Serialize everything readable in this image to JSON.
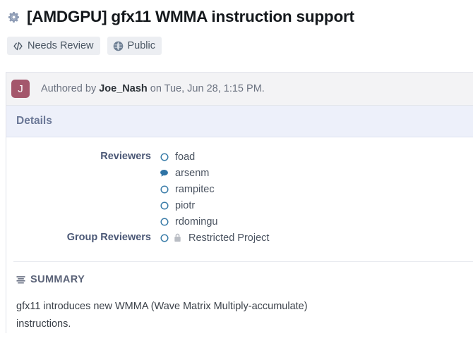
{
  "header": {
    "icon": "gear-icon",
    "title": "[AMDGPU] gfx11 WMMA instruction support",
    "badges": [
      {
        "icon": "code-brackets-icon",
        "label": "Needs Review"
      },
      {
        "icon": "globe-icon",
        "label": "Public"
      }
    ]
  },
  "author": {
    "avatar_initial": "J",
    "avatar_color": "#a4576c",
    "prefix": "Authored by ",
    "name": "Joe_Nash",
    "suffix": " on Tue, Jun 28, 1:15 PM."
  },
  "details": {
    "section_title": "Details",
    "reviewers_label": "Reviewers",
    "reviewers": [
      {
        "name": "foad",
        "icon": "circle-outline-icon",
        "status": "pending"
      },
      {
        "name": "arsenm",
        "icon": "comment-bubble-icon",
        "status": "commented"
      },
      {
        "name": "rampitec",
        "icon": "circle-outline-icon",
        "status": "pending"
      },
      {
        "name": "piotr",
        "icon": "circle-outline-icon",
        "status": "pending"
      },
      {
        "name": "rdomingu",
        "icon": "circle-outline-icon",
        "status": "pending"
      }
    ],
    "group_reviewers_label": "Group Reviewers",
    "group_reviewers": [
      {
        "name": "Restricted Project",
        "icon": "circle-outline-icon",
        "secondary_icon": "lock-icon",
        "status": "pending"
      }
    ]
  },
  "summary": {
    "icon": "align-list-icon",
    "title": "SUMMARY",
    "body": "gfx11 introduces new WMMA (Wave Matrix Multiply-accumulate) instructions."
  },
  "colors": {
    "accent_blue": "#3a7ca8",
    "badge_bg": "#eceef2",
    "details_header_bg": "#edf0fa",
    "author_strip_bg": "#f3f3f5",
    "label_color": "#4a5775"
  }
}
